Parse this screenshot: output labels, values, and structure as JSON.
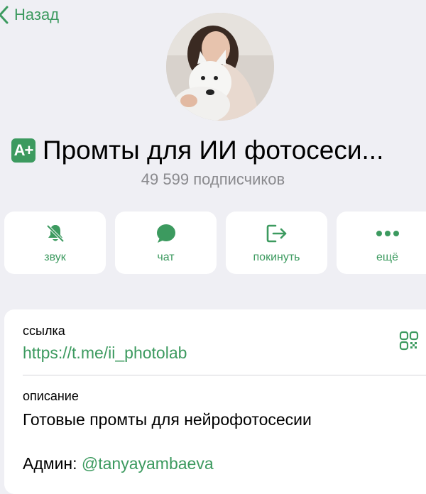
{
  "nav": {
    "back_label": "Назад"
  },
  "channel": {
    "badge": "A+",
    "title": "Промты для ИИ фотосеси...",
    "subscribers": "49 599 подписчиков"
  },
  "actions": [
    {
      "label": "звук",
      "icon": "bell-slash-icon"
    },
    {
      "label": "чат",
      "icon": "chat-bubble-icon"
    },
    {
      "label": "покинуть",
      "icon": "leave-icon"
    },
    {
      "label": "ещё",
      "icon": "more-dots-icon"
    }
  ],
  "info": {
    "link_label": "ссылка",
    "link_value": "https://t.me/ii_photolab",
    "description_label": "описание",
    "description_value": "Готовые промты для нейрофотосесии",
    "admin_prefix": "Админ:",
    "admin_handle": "@tanyayambaeva"
  },
  "colors": {
    "accent": "#3c9a5f",
    "background": "#efeff4",
    "secondary_text": "#8a8a8e"
  }
}
